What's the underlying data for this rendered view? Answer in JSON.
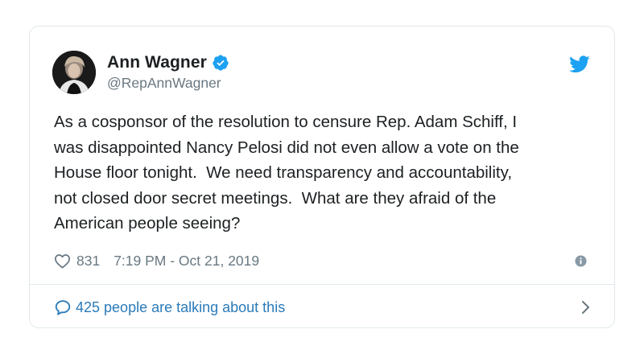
{
  "tweet": {
    "author_name": "Ann Wagner",
    "author_handle": "@RepAnnWagner",
    "verified": true,
    "text": "As a cosponsor of the resolution to censure Rep. Adam Schiff, I\nwas disappointed Nancy Pelosi did not even allow a vote on the\nHouse floor tonight.  We need transparency and accountability,\nnot closed door secret meetings.  What are they afraid of the\nAmerican people seeing?",
    "like_count": "831",
    "timestamp": "7:19 PM - Oct 21, 2019",
    "talking_text": "425 people are talking about this"
  },
  "colors": {
    "accent": "#1da1f2",
    "link": "#2b7bb9",
    "secondary_text": "#697882",
    "primary_text": "#1c2022",
    "border": "#e1e8ed"
  },
  "icons": {
    "verified": "verified-badge-icon",
    "brand": "twitter-bird-icon",
    "like": "heart-icon",
    "info": "info-icon",
    "conversation": "speech-bubble-icon",
    "chevron": "chevron-right-icon"
  }
}
